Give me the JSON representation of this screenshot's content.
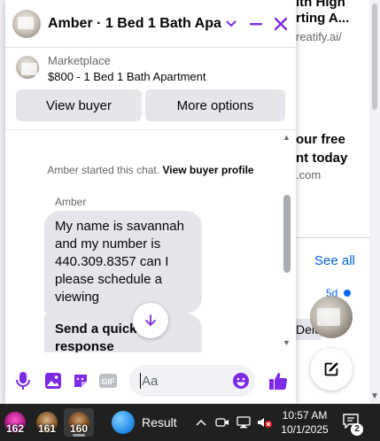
{
  "background_page": {
    "ad1_title_line1": "ith High",
    "ad1_title_line2": "rting A...",
    "ad1_domain": "reatify.ai/",
    "ad2_title_line1": "our free",
    "ad2_title_line2": "nt today",
    "ad2_domain": ".com",
    "see_all": "See all",
    "notification_age": "5d",
    "delete_partial": "Dele",
    "accent_color": "#0866ff"
  },
  "chat": {
    "title": "Amber · 1 Bed 1 Bath Apart...",
    "accent_color": "#7d2ae8",
    "listing": {
      "source": "Marketplace",
      "title": "$800 - 1 Bed 1 Bath Apartment",
      "view_buyer_label": "View buyer",
      "more_options_label": "More options"
    },
    "system_message": "Amber started this chat.",
    "system_link": "View buyer profile",
    "sender_name": "Amber",
    "messages": [
      "My name is savannah and my number is 440.309.8357 can I please schedule a viewing",
      "Send a quick response"
    ],
    "composer": {
      "placeholder": "Aa"
    }
  },
  "taskbar": {
    "apps": [
      {
        "badge": "162"
      },
      {
        "badge": "161"
      },
      {
        "badge": "160"
      }
    ],
    "weather_label": "Result",
    "time": "10:57 AM",
    "date": "10/1/2025",
    "notification_count": "2"
  }
}
